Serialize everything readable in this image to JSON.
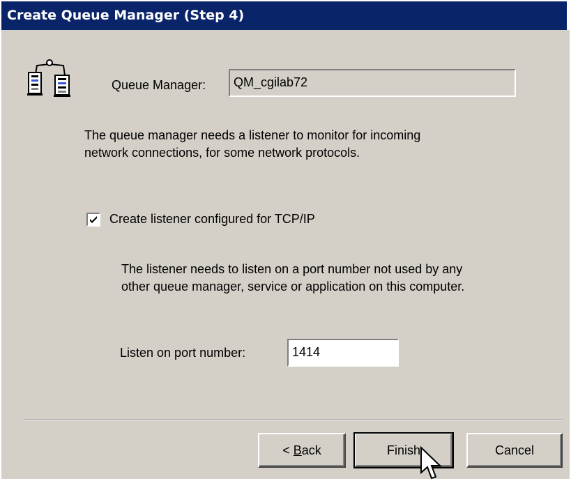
{
  "title": "Create Queue Manager (Step 4)",
  "queue_manager": {
    "label": "Queue Manager:",
    "value": "QM_cgilab72"
  },
  "listener_text": {
    "line1": "The queue manager needs a listener to monitor for incoming",
    "line2": "network connections, for some network protocols."
  },
  "tcp_checkbox": {
    "label": "Create listener configured for TCP/IP",
    "checked": true
  },
  "port_text": {
    "line1": "The listener needs to listen on a port number not used by any",
    "line2": "other queue manager, service or application on this computer."
  },
  "port": {
    "label": "Listen on port number:",
    "value": "1414"
  },
  "buttons": {
    "back_before": "< ",
    "back_underlined": "B",
    "back_after": "ack",
    "finish": "Finish",
    "cancel": "Cancel"
  },
  "colors": {
    "title_bar": "#0a246a",
    "dialog_background": "#d4d0c8"
  },
  "icons": {
    "queue_manager": "queue-manager-icon",
    "cursor": "mouse-pointer-icon"
  }
}
